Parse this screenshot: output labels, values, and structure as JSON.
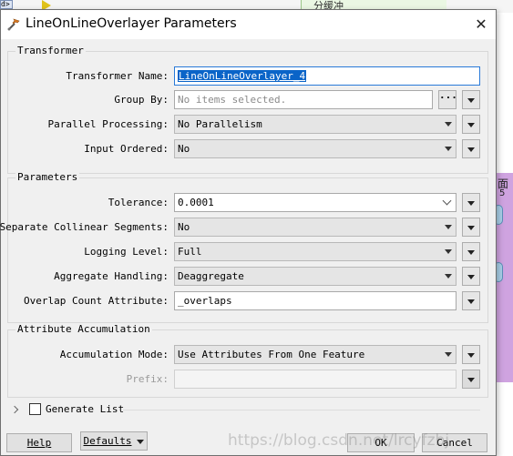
{
  "background": {
    "node_label": "分缓冲",
    "left_chip_label": "d>",
    "purple_label": "面",
    "purple_number": "5"
  },
  "dialog": {
    "title": "LineOnLineOverlayer Parameters",
    "close_glyph": "✕"
  },
  "transformer": {
    "section_title": "Transformer",
    "name_label": "Transformer Name:",
    "name_value": "LineOnLineOverlayer_4",
    "group_by_label": "Group By:",
    "group_by_placeholder": "No items selected.",
    "group_by_button": "···",
    "parallel_label": "Parallel Processing:",
    "parallel_value": "No Parallelism",
    "input_ordered_label": "Input Ordered:",
    "input_ordered_value": "No"
  },
  "parameters": {
    "section_title": "Parameters",
    "tolerance_label": "Tolerance:",
    "tolerance_value": "0.0001",
    "collinear_label": "Separate Collinear Segments:",
    "collinear_value": "No",
    "logging_label": "Logging Level:",
    "logging_value": "Full",
    "aggregate_label": "Aggregate Handling:",
    "aggregate_value": "Deaggregate",
    "overlap_label": "Overlap Count Attribute:",
    "overlap_value": "_overlaps"
  },
  "attribute_accumulation": {
    "section_title": "Attribute Accumulation",
    "mode_label": "Accumulation Mode:",
    "mode_value": "Use Attributes From One Feature",
    "prefix_label": "Prefix:",
    "prefix_value": ""
  },
  "generate_list": {
    "label": "Generate List",
    "checked": false
  },
  "footer": {
    "help_label": "Help",
    "defaults_label": "Defaults",
    "ok_label": "OK",
    "cancel_label": "Cancel"
  },
  "watermark": "https://blog.csdn.net/lrcyfzbj"
}
